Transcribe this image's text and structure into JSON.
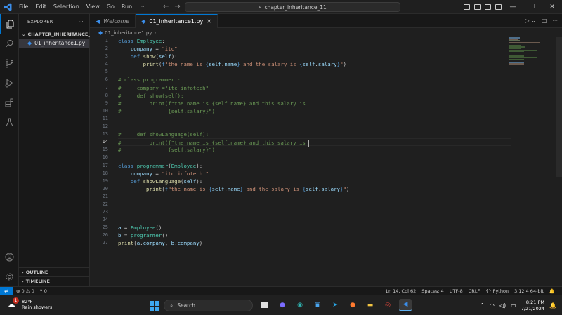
{
  "window": {
    "menu": [
      "File",
      "Edit",
      "Selection",
      "View",
      "Go",
      "Run",
      "···"
    ],
    "search_text": "chapter_inheritance_11"
  },
  "sidebar": {
    "title": "EXPLORER",
    "more": "···",
    "folder": "CHAPTER_INHERITANCE_11",
    "file": "01_inheritance1.py",
    "outline": "OUTLINE",
    "timeline": "TIMELINE"
  },
  "tabs": [
    {
      "label": "Welcome",
      "active": false
    },
    {
      "label": "01_inheritance1.py",
      "active": true
    }
  ],
  "breadcrumb": {
    "file": "01_inheritance1.py",
    "sep": "›",
    "rest": "..."
  },
  "editor": {
    "current_line": 14,
    "line_numbers": [
      "1",
      "2",
      "3",
      "4",
      "5",
      "6",
      "7",
      "8",
      "9",
      "10",
      "11",
      "12",
      "13",
      "14",
      "15",
      "16",
      "17",
      "18",
      "19",
      "20",
      "21",
      "22",
      "23",
      "24",
      "25",
      "26",
      "27"
    ]
  },
  "statusbar": {
    "problems": "⊗ 0 ⚠ 0",
    "ports": "⑂ 0",
    "position": "Ln 14, Col 62",
    "spaces": "Spaces: 4",
    "encoding": "UTF-8",
    "eol": "CRLF",
    "language": "{} Python",
    "interpreter": "3.12.4 64-bit"
  },
  "taskbar": {
    "weather_temp": "82°F",
    "weather_desc": "Rain showers",
    "weather_badge": "1",
    "search_placeholder": "Search",
    "time": "8:21 PM",
    "date": "7/21/2024"
  },
  "colors": {
    "accent": "#0078d4",
    "keyword": "#569cd6",
    "class_name": "#4ec9b0",
    "function": "#dcdcaa",
    "string": "#ce9178",
    "comment": "#6a9955"
  }
}
